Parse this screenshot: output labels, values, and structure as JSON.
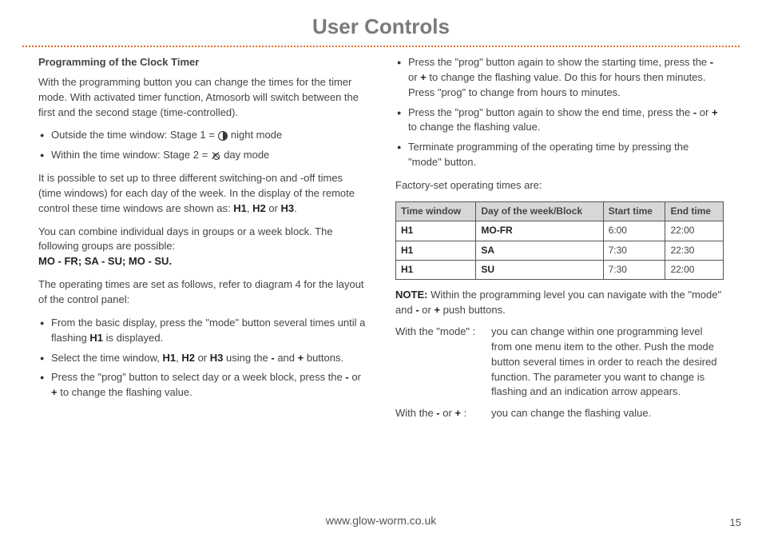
{
  "title": "User Controls",
  "left": {
    "heading": "Programming of the Clock Timer",
    "intro": "With the programming button you can change the times for the timer mode. With activated timer function, Atmosorb will switch between the first and the second stage (time-controlled).",
    "stage1_label": "Outside the time window: Stage 1 =",
    "stage1_mode": "night mode",
    "stage2_label": "Within the time window:  Stage 2 =",
    "stage2_mode": "day mode",
    "para2a": "It is possible to set up to three different switching-on and -off times (time windows) for each day of the week. In the display of the remote control these time windows are shown as: ",
    "h1": "H1",
    "h2": "H2",
    "h3": "H3",
    "para2b": ", ",
    "para2c": " or ",
    "para2d": ".",
    "para3a": "You can combine individual days in groups or a week block. The following groups are possible:",
    "groups": "MO - FR; SA - SU; MO - SU.",
    "para4": "The operating times are set as follows, refer to diagram 4 for the layout of the control panel:",
    "steps": [
      {
        "a": "From the basic display, press the \"mode\" button several times until a flashing ",
        "b": "H1",
        "c": " is displayed."
      },
      {
        "a": "Select the time window, ",
        "b": "H1",
        "c": ", ",
        "d": "H2",
        "e": " or ",
        "f": "H3",
        "g": " using the ",
        "h": "-",
        "i": " and ",
        "j": "+",
        "k": " buttons."
      },
      {
        "a": "Press the \"prog\" button to select day or a week block, press the ",
        "b": "-",
        "c": " or ",
        "d": "+",
        "e": " to change the flashing value."
      }
    ]
  },
  "right": {
    "steps": [
      {
        "a": "Press the \"prog\" button again to show the starting time, press the ",
        "b": "-",
        "c": " or ",
        "d": "+",
        "e": " to change the flashing value. Do this for hours then minutes. Press \"prog\" to change from hours to minutes."
      },
      {
        "a": "Press the \"prog\" button again to show the end time, press the ",
        "b": "-",
        "c": " or ",
        "d": "+",
        "e": " to change the flashing value."
      },
      {
        "a": "Terminate programming of the operating time by pressing the \"mode\" button."
      }
    ],
    "factory_line": "Factory-set operating times are:",
    "table": {
      "headers": [
        "Time window",
        "Day of the week/Block",
        "Start time",
        "End time"
      ],
      "rows": [
        [
          "H1",
          "MO-FR",
          "6:00",
          "22:00"
        ],
        [
          "H1",
          "SA",
          "7:30",
          "22:30"
        ],
        [
          "H1",
          "SU",
          "7:30",
          "22:00"
        ]
      ]
    },
    "note_label": "NOTE:",
    "note_text": " Within the programming level you can navigate with the \"mode\" and ",
    "note_minus": "-",
    "note_or": " or ",
    "note_plus": "+",
    "note_tail": " push buttons.",
    "mode_term_a": "With the \"mode\" :",
    "mode_body": "you can change within one programming level from one menu item to the other. Push the mode button several times in order to reach the desired function. The parameter you want to change is flashing and an indication arrow appears.",
    "pm_term_a": "With the ",
    "pm_term_b": "-",
    "pm_term_c": " or ",
    "pm_term_d": "+",
    "pm_term_e": " :",
    "pm_body": "you can change the flashing value."
  },
  "footer": "www.glow-worm.co.uk",
  "page_number": "15"
}
